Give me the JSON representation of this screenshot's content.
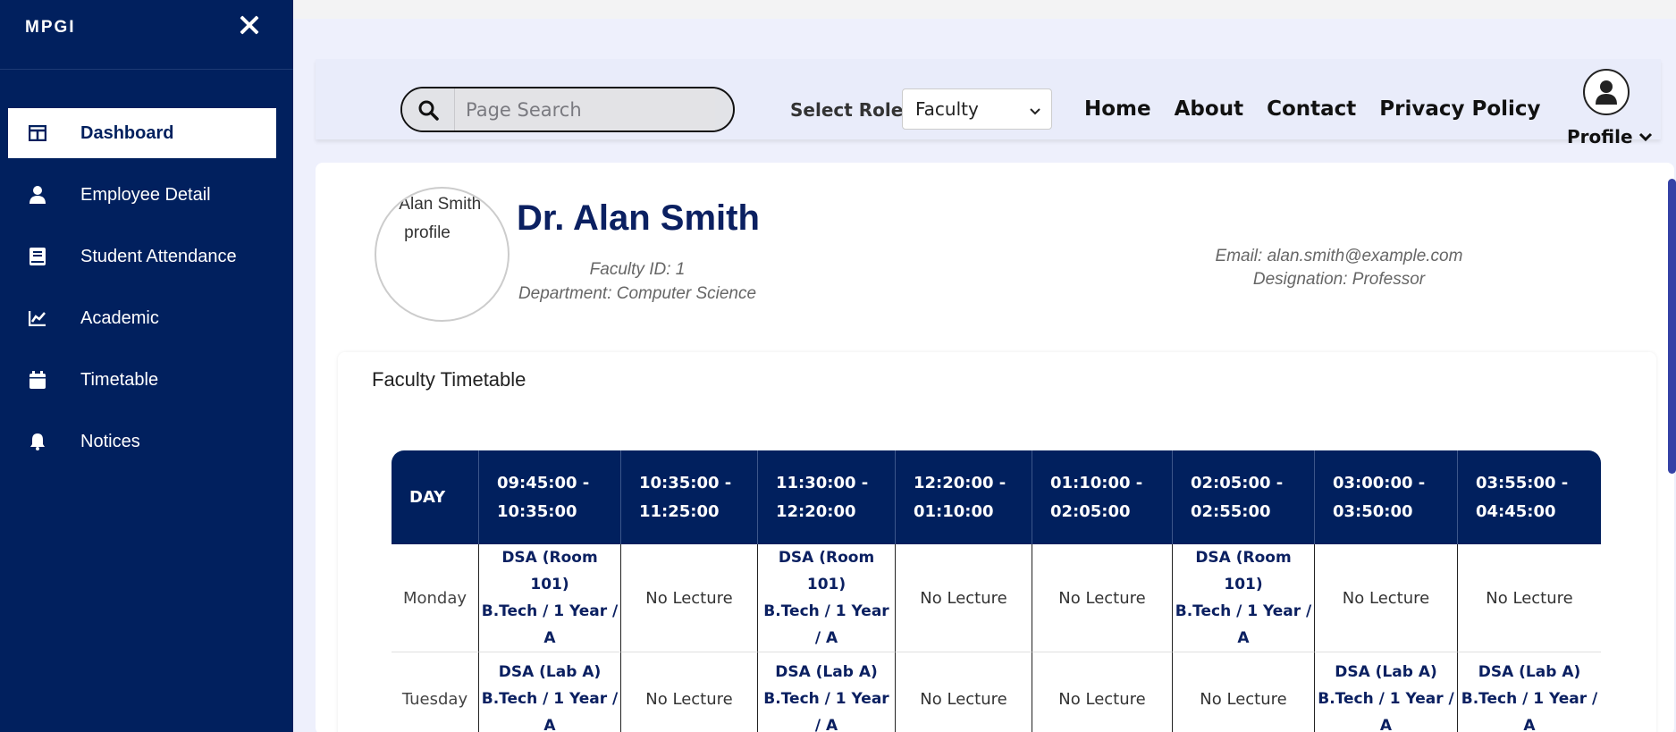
{
  "sidebar": {
    "brand": "MPGI",
    "items": [
      {
        "label": "Dashboard",
        "icon": "columns-icon"
      },
      {
        "label": "Employee Detail",
        "icon": "user-icon"
      },
      {
        "label": "Student Attendance",
        "icon": "book-icon"
      },
      {
        "label": "Academic",
        "icon": "chart-icon"
      },
      {
        "label": "Timetable",
        "icon": "calendar-icon"
      },
      {
        "label": "Notices",
        "icon": "bell-icon"
      }
    ]
  },
  "header": {
    "search_placeholder": "Page Search",
    "role_label": "Select Role:",
    "role_value": "Faculty",
    "links": [
      "Home",
      "About",
      "Contact",
      "Privacy Policy"
    ],
    "profile_label": "Profile"
  },
  "profile": {
    "image_alt": "Dr. Alan Smith profile",
    "name": "Dr. Alan Smith",
    "faculty_id": "Faculty ID: 1",
    "department": "Department: Computer Science",
    "email": "Email: alan.smith@example.com",
    "designation": "Designation: Professor"
  },
  "timetable": {
    "title": "Faculty Timetable",
    "day_header": "DAY",
    "slots": [
      [
        "09:45:00 -",
        "10:35:00"
      ],
      [
        "10:35:00 -",
        "11:25:00"
      ],
      [
        "11:30:00 -",
        "12:20:00"
      ],
      [
        "12:20:00 -",
        "01:10:00"
      ],
      [
        "01:10:00 -",
        "02:05:00"
      ],
      [
        "02:05:00 -",
        "02:55:00"
      ],
      [
        "03:00:00 -",
        "03:50:00"
      ],
      [
        "03:55:00 -",
        "04:45:00"
      ]
    ],
    "rows": [
      {
        "day": "Monday",
        "cells": [
          {
            "subject": "DSA (Room 101)",
            "group": "B.Tech / 1 Year / A"
          },
          {
            "empty": "No Lecture"
          },
          {
            "subject": "DSA (Room 101)",
            "group": "B.Tech / 1 Year / A"
          },
          {
            "empty": "No Lecture"
          },
          {
            "empty": "No Lecture"
          },
          {
            "subject": "DSA (Room 101)",
            "group": "B.Tech / 1 Year / A"
          },
          {
            "empty": "No Lecture"
          },
          {
            "empty": "No Lecture"
          }
        ]
      },
      {
        "day": "Tuesday",
        "cells": [
          {
            "subject": "DSA (Lab A)",
            "group": "B.Tech / 1 Year / A"
          },
          {
            "empty": "No Lecture"
          },
          {
            "subject": "DSA (Lab A)",
            "group": "B.Tech / 1 Year / A"
          },
          {
            "empty": "No Lecture"
          },
          {
            "empty": "No Lecture"
          },
          {
            "empty": "No Lecture"
          },
          {
            "subject": "DSA (Lab A)",
            "group": "B.Tech / 1 Year / A"
          },
          {
            "subject": "DSA (Lab A)",
            "group": "B.Tech / 1 Year / A"
          }
        ]
      }
    ]
  },
  "colors": {
    "sidebar_bg": "#01205e",
    "main_bg": "#eef0fc",
    "accent_text": "#0b2061"
  }
}
